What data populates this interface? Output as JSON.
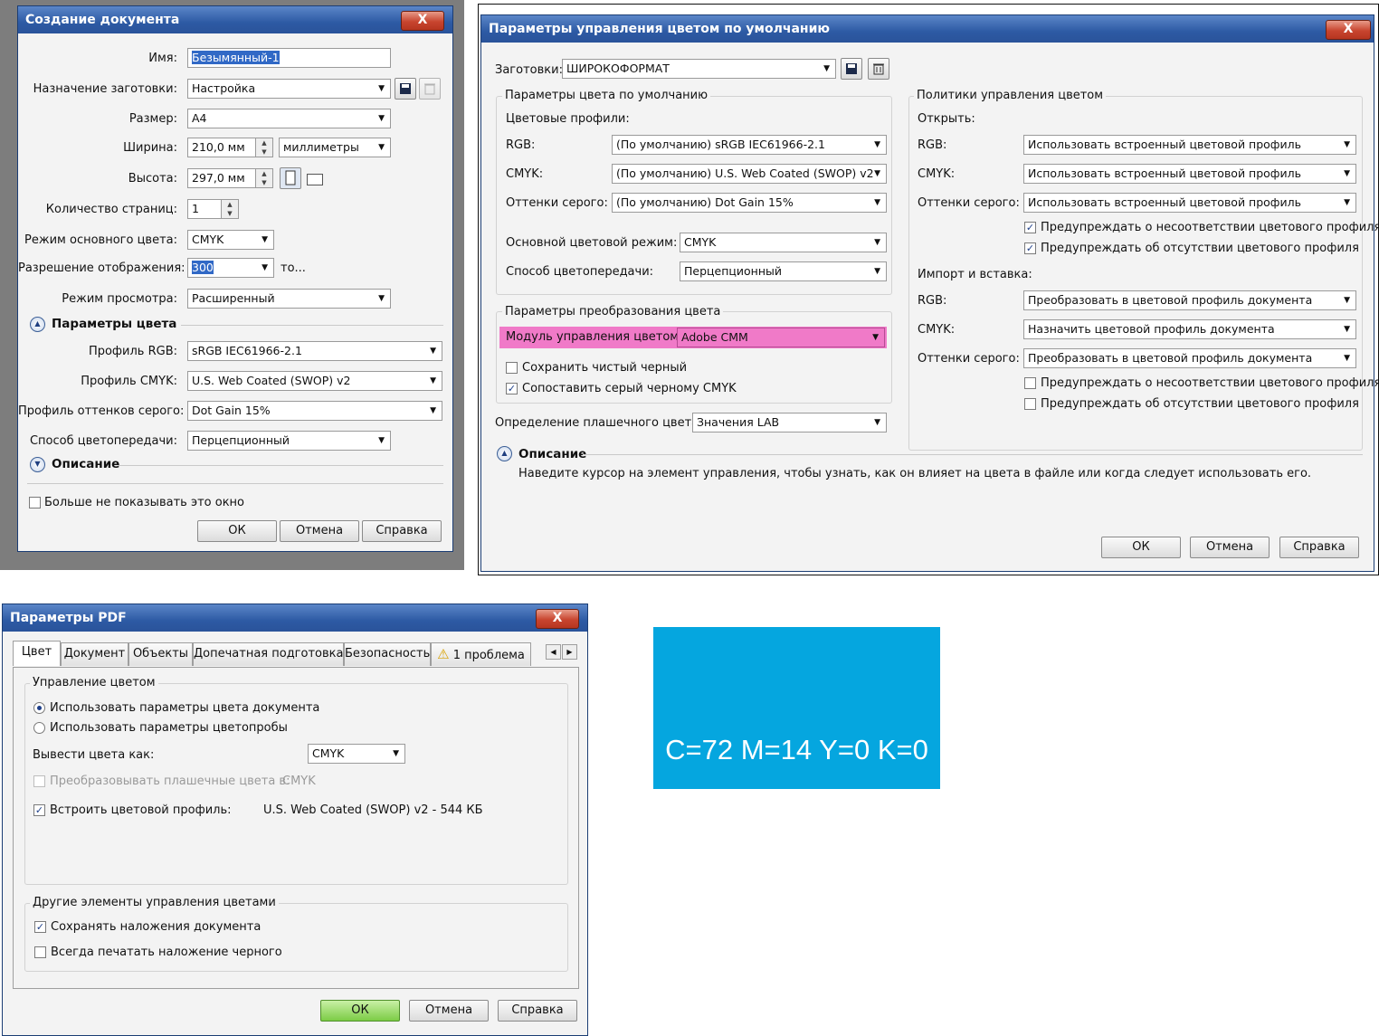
{
  "dialog1": {
    "title": "Создание документа",
    "close": "X",
    "labels": {
      "name": "Имя:",
      "preset": "Назначение заготовки:",
      "size": "Размер:",
      "width": "Ширина:",
      "height": "Высота:",
      "pages": "Количество страниц:",
      "color_mode": "Режим основного цвета:",
      "resolution": "Разрешение отображения:",
      "preview": "Режим просмотра:",
      "rgb_profile": "Профиль RGB:",
      "cmyk_profile": "Профиль CMYK:",
      "gray_profile": "Профиль оттенков серого:",
      "rendering": "Способ цветопередачи:"
    },
    "values": {
      "name": "Безымянный-1",
      "preset": "Настройка",
      "size": "A4",
      "width": "210,0 мм",
      "units": "миллиметры",
      "height": "297,0 мм",
      "pages": "1",
      "color_mode": "CMYK",
      "resolution": "300",
      "resolution_suffix": "то...",
      "preview": "Расширенный",
      "rgb_profile": "sRGB IEC61966-2.1",
      "cmyk_profile": "U.S. Web Coated (SWOP) v2",
      "gray_profile": "Dot Gain 15%",
      "rendering": "Перцепционный"
    },
    "section_color": "Параметры цвета",
    "section_desc": "Описание",
    "dont_show": "Больше не показывать это окно",
    "ok": "ОК",
    "cancel": "Отмена",
    "help": "Справка"
  },
  "dialog2": {
    "title": "Параметры управления цветом по умолчанию",
    "close": "X",
    "presets_label": "Заготовки:",
    "presets_value": "ШИРОКОФОРМАТ",
    "default_group": "Параметры цвета по умолчанию",
    "profiles_label": "Цветовые профили:",
    "rgb_label": "RGB:",
    "rgb_value": "(По умолчанию) sRGB IEC61966-2.1",
    "cmyk_label": "CMYK:",
    "cmyk_value": "(По умолчанию) U.S. Web Coated (SWOP) v2",
    "gray_label": "Оттенки серого:",
    "gray_value": "(По умолчанию) Dot Gain 15%",
    "primary_mode_label": "Основной цветовой режим:",
    "primary_mode_value": "CMYK",
    "rendering_label": "Способ цветопередачи:",
    "rendering_value": "Перцепционный",
    "convert_group": "Параметры преобразования цвета",
    "cmm_label": "Модуль управления цветом:",
    "cmm_value": "Adobe CMM",
    "highlight_color": "#f07ac8",
    "preserve_black": "Сохранить чистый черный",
    "map_gray": "Сопоставить серый черному CMYK",
    "spot_label": "Определение плашечного цвета:",
    "spot_value": "Значения LAB",
    "policies_group": "Политики управления цветом",
    "open_label": "Открыть:",
    "open_rgb": "Использовать встроенный цветовой профиль",
    "open_cmyk": "Использовать встроенный цветовой профиль",
    "open_gray": "Использовать встроенный цветовой профиль",
    "warn_mismatch": "Предупреждать о несоответствии цветового профиля",
    "warn_missing": "Предупреждать об отсутствии цветового профиля",
    "import_label": "Импорт и вставка:",
    "import_rgb": "Преобразовать в цветовой профиль документа",
    "import_cmyk": "Назначить цветовой профиль документа",
    "import_gray": "Преобразовать в цветовой профиль документа",
    "warn_mismatch2": "Предупреждать о несоответствии цветового профиля",
    "warn_missing2": "Предупреждать об отсутствии цветового профиля",
    "desc_title": "Описание",
    "desc_text": "Наведите курсор на элемент управления, чтобы узнать, как он влияет на цвета в файле или когда следует использовать его.",
    "ok": "ОК",
    "cancel": "Отмена",
    "help": "Справка"
  },
  "dialog3": {
    "title": "Параметры PDF",
    "close": "X",
    "tabs": [
      "Цвет",
      "Документ",
      "Объекты",
      "Допечатная подготовка",
      "Безопасность",
      "1 проблема"
    ],
    "color_mgmt_group": "Управление цветом",
    "radio1": "Использовать параметры цвета документа",
    "radio2": "Использовать параметры цветопробы",
    "output_as_label": "Вывести цвета как:",
    "output_as_value": "CMYK",
    "convert_spot": "Преобразовывать плашечные цвета в:",
    "convert_spot_value": "CMYK",
    "embed_profile": "Встроить цветовой профиль:",
    "embed_profile_value": "U.S. Web Coated (SWOP) v2 - 544 КБ",
    "other_group": "Другие элементы управления цветами",
    "keep_overprint": "Сохранять наложения документа",
    "always_overprint_black": "Всегда печатать наложение черного",
    "ok": "ОК",
    "cancel": "Отмена",
    "help": "Справка"
  },
  "swatch": {
    "text": "C=72 M=14 Y=0 K=0",
    "color": "#05a6df"
  }
}
